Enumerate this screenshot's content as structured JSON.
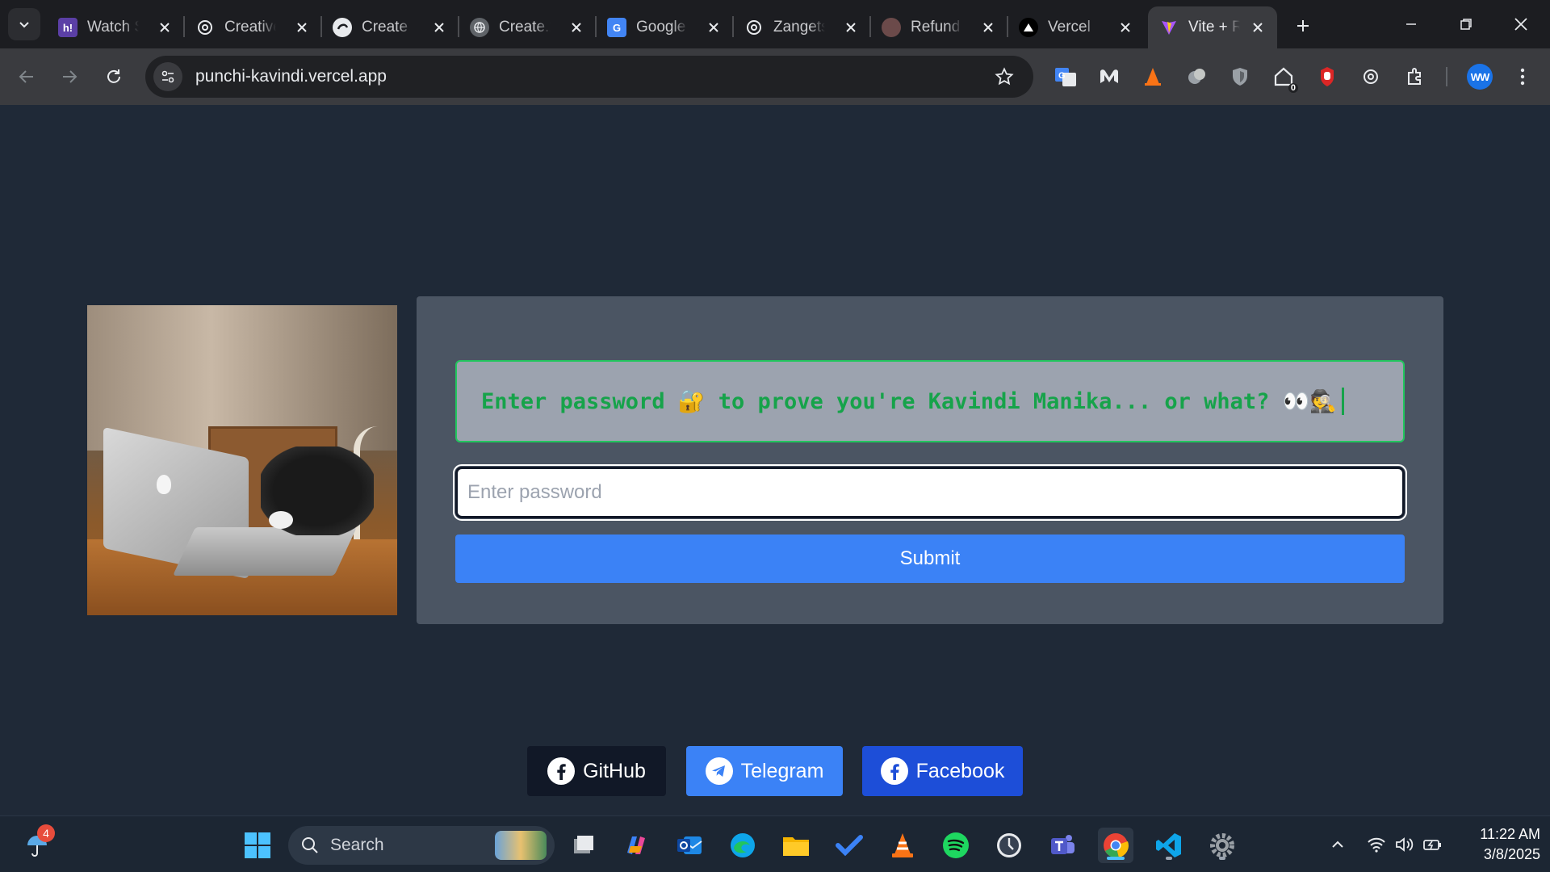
{
  "browser": {
    "tabs": [
      {
        "title": "Watch S",
        "favicon": "hianime-icon",
        "active": false
      },
      {
        "title": "Creative",
        "favicon": "chatgpt-icon",
        "active": false
      },
      {
        "title": "Create",
        "favicon": "edge-icon",
        "active": false
      },
      {
        "title": "Create.x",
        "favicon": "globe-icon",
        "active": false
      },
      {
        "title": "Google",
        "favicon": "google-translate-icon",
        "active": false
      },
      {
        "title": "Zangets",
        "favicon": "chatgpt-icon",
        "active": false
      },
      {
        "title": "Refund",
        "favicon": "refund-icon",
        "active": false
      },
      {
        "title": "Vercel",
        "favicon": "vercel-icon",
        "active": false
      },
      {
        "title": "Vite + R",
        "favicon": "vite-icon",
        "active": true
      }
    ],
    "url": "punchi-kavindi.vercel.app",
    "profile_initials": "WW",
    "extension_badge": "0"
  },
  "page": {
    "prompt_text": "Enter password 🔐 to prove you're Kavindi Manika... or what? 👀🕵️",
    "password_placeholder": "Enter password",
    "submit_label": "Submit",
    "social": [
      {
        "label": "GitHub",
        "icon": "facebook-icon",
        "color": "#111827"
      },
      {
        "label": "Telegram",
        "icon": "telegram-icon",
        "color": "#3b82f6"
      },
      {
        "label": "Facebook",
        "icon": "facebook-icon",
        "color": "#1d4ed8"
      }
    ]
  },
  "taskbar": {
    "search_label": "Search",
    "weather_badge": "4",
    "time": "11:22 AM",
    "date": "3/8/2025"
  },
  "colors": {
    "page_bg": "#1f2937",
    "card_bg": "#4b5563",
    "prompt_green": "#16a34a",
    "submit_blue": "#3b82f6"
  }
}
